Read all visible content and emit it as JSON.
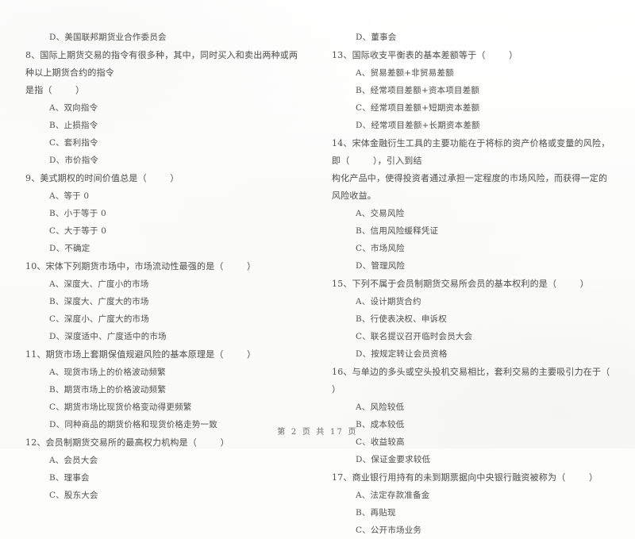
{
  "document": {
    "type": "scanned-exam-paper",
    "subject_language": "zh-CN"
  },
  "left_column": {
    "blocks": [
      {
        "kind": "option",
        "id": "q7-option-d",
        "text": "D、美国联邦期货业合作委员会"
      },
      {
        "kind": "question",
        "id": "q8",
        "lines": [
          "8、国际上期货交易的指令有很多种，其中，同时买入和卖出两种或两种以上期货合约的指令",
          "是指（        ）"
        ],
        "options": [
          "A、双向指令",
          "B、止损指令",
          "C、套利指令",
          "D、市价指令"
        ]
      },
      {
        "kind": "question",
        "id": "q9",
        "lines": [
          "9、美式期权的时间价值总是（        ）"
        ],
        "options": [
          "A、等于 0",
          "B、小于等于 0",
          "C、大于等于 0",
          "D、不确定"
        ]
      },
      {
        "kind": "question",
        "id": "q10",
        "lines": [
          "10、宋体下列期货市场中，市场流动性最强的是（        ）"
        ],
        "options": [
          "A、深度大、广度小的市场",
          "B、深度大、广度大的市场",
          "C、深度小、广度大的市场",
          "D、深度适中、广度适中的市场"
        ]
      },
      {
        "kind": "question",
        "id": "q11",
        "lines": [
          "11、期货市场上套期保值规避风险的基本原理是（        ）"
        ],
        "options": [
          "A、现货市场上的价格波动频繁",
          "B、期货市场上的价格波动频繁",
          "C、期货市场比现货价格变动得更频繁",
          "D、同种商品的期货价格和现货价格走势一致"
        ]
      },
      {
        "kind": "question",
        "id": "q12",
        "lines": [
          "12、会员制期货交易所的最高权力机构是（        ）"
        ],
        "options": [
          "A、会员大会",
          "B、理事会",
          "C、股东大会"
        ]
      }
    ]
  },
  "right_column": {
    "blocks": [
      {
        "kind": "option",
        "id": "q12-option-d",
        "text": "D、董事会"
      },
      {
        "kind": "question",
        "id": "q13",
        "lines": [
          "13、国际收支平衡表的基本差额等于（        ）"
        ],
        "options": [
          "A、贸易差额+非贸易差额",
          "B、经常项目差额+资本项目差额",
          "C、经常项目差额+短期资本差额",
          "D、经常项目差额+长期资本差额"
        ]
      },
      {
        "kind": "question",
        "id": "q14",
        "lines": [
          "14、宋体金融衍生工具的主要功能在于将标的资产价格或变量的风险，即（        ），引入到结",
          "构化产品中，使得投资者通过承担一定程度的市场风险，而获得一定的风险收益。"
        ],
        "options": [
          "A、交易风险",
          "B、信用风险缓释凭证",
          "C、市场风险",
          "D、管理风险"
        ]
      },
      {
        "kind": "question",
        "id": "q15",
        "lines": [
          "15、下列不属于会员制期货交易所会员的基本权利的是（        ）"
        ],
        "options": [
          "A、设计期货合约",
          "B、行使表决权、申诉权",
          "C、联名提议召开临时会员大会",
          "D、按规定转让会员资格"
        ]
      },
      {
        "kind": "question",
        "id": "q16",
        "lines": [
          "16、与单边的多头或空头投机交易相比，套利交易的主要吸引力在于（        ）"
        ],
        "options": [
          "A、风险较低",
          "B、成本较低",
          "C、收益较高",
          "D、保证金要求较低"
        ]
      },
      {
        "kind": "question",
        "id": "q17",
        "lines": [
          "17、商业银行用持有的未到期票据向中央银行融资被称为（        ）"
        ],
        "options": [
          "A、法定存款准备金",
          "B、再贴现",
          "C、公开市场业务"
        ]
      }
    ]
  },
  "footer": {
    "page_label": "第 2 页 共 17 页"
  }
}
